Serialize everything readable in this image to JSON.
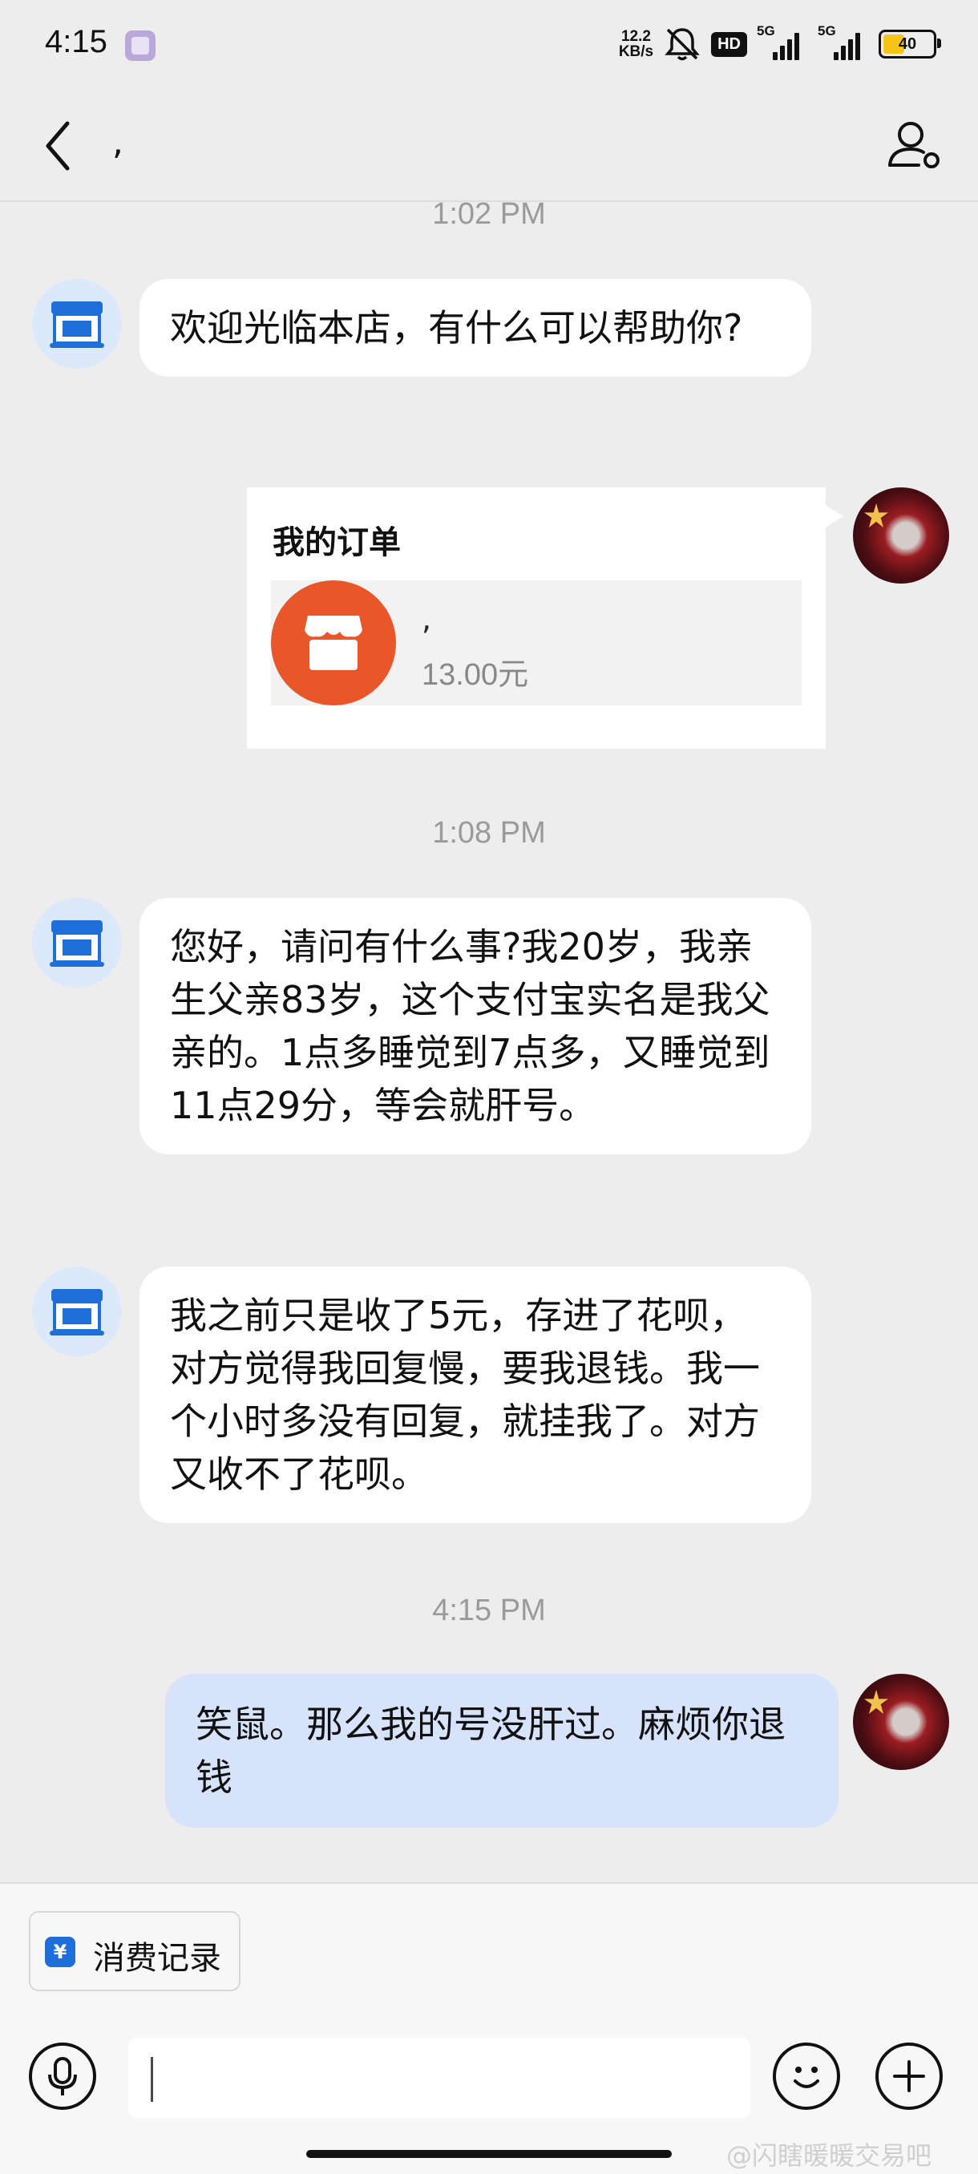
{
  "status_bar": {
    "time": "4:15",
    "net_speed_value": "12.2",
    "net_speed_unit": "KB/s",
    "hd_label": "HD",
    "signal1_label": "5G",
    "signal2_label": "5G",
    "battery": "40",
    "icons": [
      "app-notification-icon",
      "mute-icon",
      "hd-icon",
      "signal-icon",
      "battery-icon"
    ]
  },
  "header": {
    "title": ","
  },
  "chat": {
    "timestamps": [
      "1:02 PM",
      "1:08 PM",
      "4:15 PM"
    ],
    "messages": [
      {
        "side": "left",
        "text": "欢迎光临本店，有什么可以帮助你?"
      },
      {
        "side": "left",
        "text": "您好，请问有什么事?我20岁，我亲生父亲83岁，这个支付宝实名是我父亲的。1点多睡觉到7点多，又睡觉到11点29分，等会就肝号。"
      },
      {
        "side": "left",
        "text": "我之前只是收了5元，存进了花呗，对方觉得我回复慢，要我退钱。我一个小时多没有回复，就挂我了。对方又收不了花呗。"
      },
      {
        "side": "right",
        "text": "笑鼠。那么我的号没肝过。麻烦你退钱"
      }
    ],
    "order_card": {
      "title": "我的订单",
      "item_name": ",",
      "item_price": "13.00元"
    }
  },
  "bottom": {
    "records_label": "消费记录",
    "records_icon_glyph": "¥",
    "input_value": "",
    "watermark": "@闪瞎暖暖交易吧"
  },
  "colors": {
    "background": "#ededed",
    "bubble_left": "#ffffff",
    "bubble_right": "#d6e3fa",
    "shop_icon_blue": "#1e6fd9",
    "order_icon_orange": "#e8562a"
  }
}
